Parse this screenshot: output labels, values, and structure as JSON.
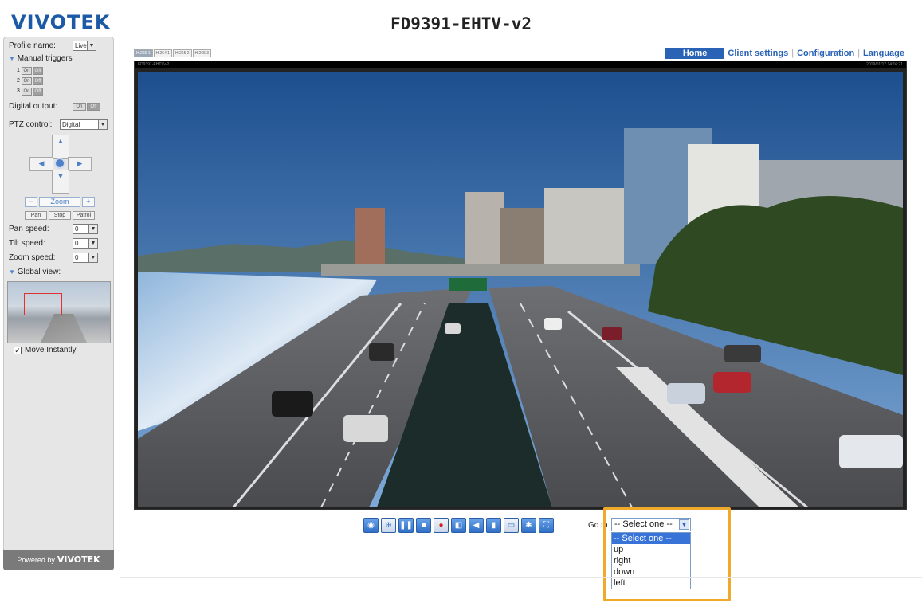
{
  "header": {
    "logo": "VIVOTEK",
    "title": "FD9391-EHTV-v2"
  },
  "nav": {
    "home": "Home",
    "client_settings": "Client settings",
    "configuration": "Configuration",
    "language": "Language"
  },
  "resolution_tabs": [
    "H.265 1",
    "H.264 1",
    "H.265 2",
    "H.265 3"
  ],
  "video": {
    "overlay_left": "FD9391-EHTV-v2",
    "overlay_timestamp": "2019/01/17 14:16:21"
  },
  "left_panel": {
    "profile_label": "Profile name:",
    "profile_value": "Live",
    "manual_triggers_label": "Manual triggers",
    "triggers": [
      {
        "index": "1",
        "on": "On",
        "off": "Off"
      },
      {
        "index": "2",
        "on": "On",
        "off": "Off"
      },
      {
        "index": "3",
        "on": "On",
        "off": "Off"
      }
    ],
    "digital_output_label": "Digital output:",
    "digital_output_on": "On",
    "digital_output_off": "Off",
    "ptz_control_label": "PTZ control:",
    "ptz_control_value": "Digital",
    "zoom_minus": "−",
    "zoom_label": "Zoom",
    "zoom_plus": "+",
    "pan_button": "Pan",
    "stop_button": "Stop",
    "patrol_button": "Patrol",
    "pan_speed_label": "Pan speed:",
    "pan_speed_value": "0",
    "tilt_speed_label": "Tilt speed:",
    "tilt_speed_value": "0",
    "zoom_speed_label": "Zoom speed:",
    "zoom_speed_value": "0",
    "global_view_label": "Global view:",
    "move_instantly_label": "Move Instantly",
    "powered_by": "Powered by",
    "powered_brand": "VIVOTEK"
  },
  "goto": {
    "label": "Go to",
    "selected": "-- Select one --",
    "options": [
      "-- Select one --",
      "up",
      "right",
      "down",
      "left"
    ]
  },
  "colors": {
    "brand_blue": "#2a62b5",
    "highlight": "#f0a92a"
  }
}
